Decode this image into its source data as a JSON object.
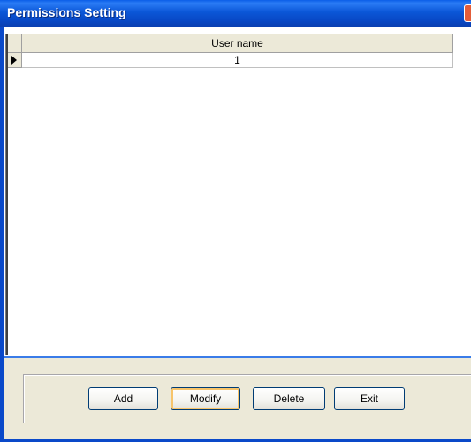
{
  "window": {
    "title": "Permissions Setting"
  },
  "grid": {
    "columns": [
      "User name"
    ],
    "rows": [
      {
        "user_name": "1"
      }
    ]
  },
  "buttons": {
    "add": "Add",
    "modify": "Modify",
    "delete": "Delete",
    "exit": "Exit"
  },
  "colors": {
    "titlebar": "#0b57d8",
    "panel": "#ece9d8",
    "focus_highlight": "#f7c46a"
  }
}
